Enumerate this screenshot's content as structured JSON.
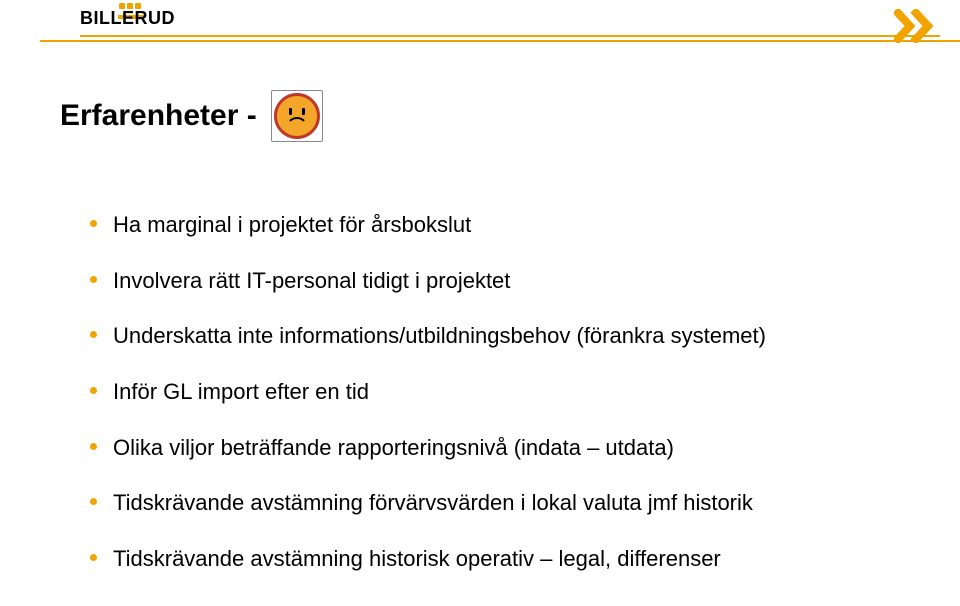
{
  "brand": "BILLERUD",
  "title": "Erfarenheter  -",
  "emoticon_alt": "sad-face",
  "bullets": [
    "Ha marginal i projektet för årsbokslut",
    "Involvera rätt IT-personal tidigt i projektet",
    "Underskatta inte informations/utbildningsbehov (förankra systemet)",
    "Inför GL import efter en tid",
    "Olika viljor beträffande rapporteringsnivå (indata – utdata)",
    "Tidskrävande avstämning förvärvsvärden i lokal valuta jmf historik",
    "Tidskrävande avstämning historisk operativ – legal, differenser"
  ],
  "colors": {
    "accent": "#f1a400",
    "face_border": "#c0372a",
    "face_fill": "#f4a62a"
  }
}
